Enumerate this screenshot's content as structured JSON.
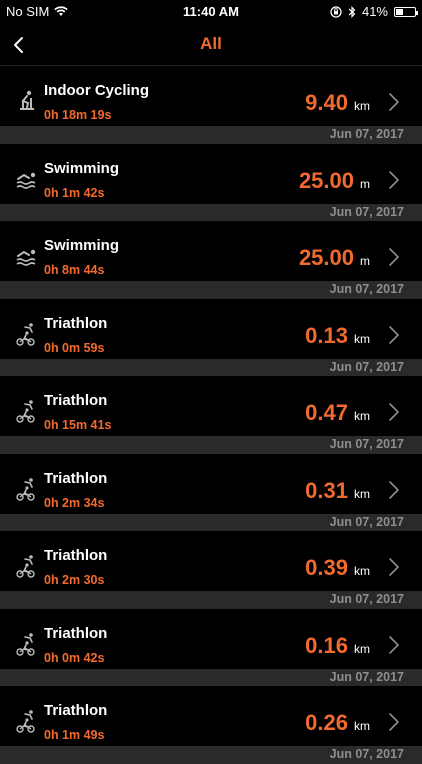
{
  "status": {
    "carrier": "No SIM",
    "time": "11:40 AM",
    "battery": "41%",
    "battery_level": 0.41
  },
  "nav": {
    "title": "All"
  },
  "activities": [
    {
      "name": "Indoor Cycling",
      "duration": "0h 18m 19s",
      "distance": "9.40",
      "unit": "km",
      "date": "Jun 07, 2017",
      "icon": "indoor-cycling-icon"
    },
    {
      "name": "Swimming",
      "duration": "0h 1m 42s",
      "distance": "25.00",
      "unit": "m",
      "date": "Jun 07, 2017",
      "icon": "swimming-icon"
    },
    {
      "name": "Swimming",
      "duration": "0h 8m 44s",
      "distance": "25.00",
      "unit": "m",
      "date": "Jun 07, 2017",
      "icon": "swimming-icon"
    },
    {
      "name": "Triathlon",
      "duration": "0h 0m 59s",
      "distance": "0.13",
      "unit": "km",
      "date": "Jun 07, 2017",
      "icon": "triathlon-icon"
    },
    {
      "name": "Triathlon",
      "duration": "0h 15m 41s",
      "distance": "0.47",
      "unit": "km",
      "date": "Jun 07, 2017",
      "icon": "triathlon-icon"
    },
    {
      "name": "Triathlon",
      "duration": "0h 2m 34s",
      "distance": "0.31",
      "unit": "km",
      "date": "Jun 07, 2017",
      "icon": "triathlon-icon"
    },
    {
      "name": "Triathlon",
      "duration": "0h 2m 30s",
      "distance": "0.39",
      "unit": "km",
      "date": "Jun 07, 2017",
      "icon": "triathlon-icon"
    },
    {
      "name": "Triathlon",
      "duration": "0h 0m 42s",
      "distance": "0.16",
      "unit": "km",
      "date": "Jun 07, 2017",
      "icon": "triathlon-icon"
    },
    {
      "name": "Triathlon",
      "duration": "0h 1m 49s",
      "distance": "0.26",
      "unit": "km",
      "date": "Jun 07, 2017",
      "icon": "triathlon-icon"
    }
  ],
  "colors": {
    "accent": "#f26a2e",
    "background": "#000000",
    "date_bar": "#2a2a2a",
    "date_text": "#8e8e8e"
  }
}
